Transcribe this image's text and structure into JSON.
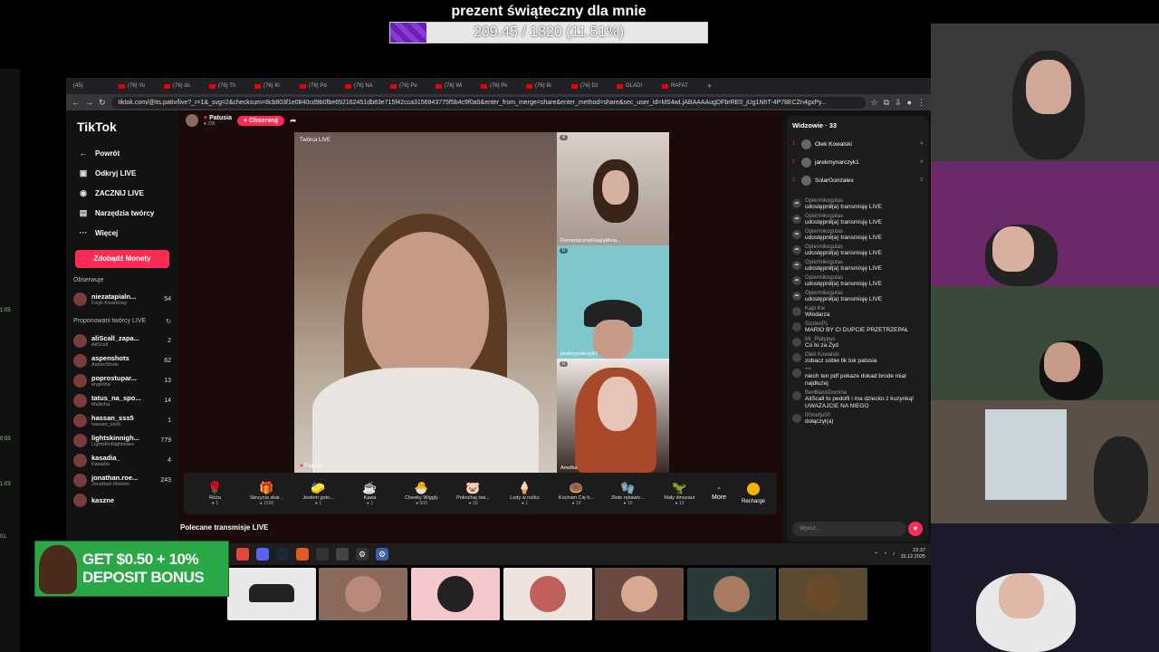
{
  "overlay": {
    "goal_title": "prezent świąteczny dla mnie",
    "goal_text": "209.45 / 1820 (11.51%)",
    "goal_fraction": 0.1151,
    "goal_color": "#6a1fb5"
  },
  "browser": {
    "tabs": [
      "(45)",
      "(76) Yo",
      "(76) do",
      "(76) Th",
      "(76) Ki",
      "(76) Pd",
      "(76) NA",
      "(76) Pe",
      "(76) Wi",
      "(76) Pk",
      "(76) Bi",
      "(76) Dz",
      "GLADI",
      "RAFAT"
    ],
    "url": "tiktok.com/@its.pativ/live?_r=1&_svg=2&checksum=8cb803f1e0840cd9b0fbe692162451db83e715f42cca3156943775f5b4c9f0a5&enter_from_merge=share&enter_method=share&sec_user_id=MS4wLjABAAAAugDFbrRE0_jUg1NhT-4P78ECZn4gxPy..."
  },
  "sidebar": {
    "logo": "TikTok",
    "items": [
      {
        "icon": "back-icon",
        "glyph": "←",
        "label": "Powrót"
      },
      {
        "icon": "live-icon",
        "glyph": "▣",
        "label": "Odkryj LIVE"
      },
      {
        "icon": "broadcast-icon",
        "glyph": "◉",
        "label": "ZACZNIJ LIVE"
      },
      {
        "icon": "tools-icon",
        "glyph": "▤",
        "label": "Narzędzia twórcy"
      },
      {
        "icon": "more-icon",
        "glyph": "···",
        "label": "Więcej"
      }
    ],
    "coins_button": "Zdobądź Monety",
    "following_title": "Obserwuje",
    "following": [
      {
        "name": "niezatapialn...",
        "sub": "Fizyk Kwantowy",
        "count": "54"
      }
    ],
    "suggested_title": "Proponowani twórcy LIVE",
    "suggested": [
      {
        "name": "aliScall_zapa...",
        "sub": "AliScall",
        "count": "2"
      },
      {
        "name": "aspenshots",
        "sub": "AspenShots",
        "count": "62"
      },
      {
        "name": "poprostupar...",
        "sub": "engelina",
        "count": "13"
      },
      {
        "name": "tatus_na_spo...",
        "sub": "Maliicha",
        "count": "14"
      },
      {
        "name": "hassan_sss5",
        "sub": "hassan_sss5",
        "count": "1"
      },
      {
        "name": "lightskinnigh...",
        "sub": "LightskinNightmare",
        "count": "779"
      },
      {
        "name": "kasadia_",
        "sub": "Kasadia",
        "count": "4"
      },
      {
        "name": "jonathan.roe...",
        "sub": "Jonathan Roehm",
        "count": "243"
      },
      {
        "name": "kaszne",
        "sub": "",
        "count": ""
      }
    ]
  },
  "stream": {
    "host_name": "Patusia",
    "host_viewers": "235",
    "follow_label": "+ Obserwuj",
    "creator_label": "Twórca LIVE",
    "main_name": "Patusia",
    "guests": [
      {
        "name": "RomantycznyKsiążęMeta...",
        "badge": "4"
      },
      {
        "name": "jarekmynarczyk1",
        "badge": "0"
      },
      {
        "name": "Amelka",
        "badge": "0"
      }
    ],
    "gifts": [
      {
        "icon": "🌹",
        "name": "Róża",
        "price": "1"
      },
      {
        "icon": "🎁",
        "name": "Skrzynia skar...",
        "price": "1500"
      },
      {
        "icon": "🧽",
        "name": "Jestem goto...",
        "price": "1"
      },
      {
        "icon": "☕",
        "name": "Kawa",
        "price": "1"
      },
      {
        "icon": "🐣",
        "name": "Cheeky Wiggly",
        "price": "500"
      },
      {
        "icon": "🐷",
        "name": "Pokochaj świ...",
        "price": "10"
      },
      {
        "icon": "🍦",
        "name": "Lody w rożku",
        "price": "1"
      },
      {
        "icon": "🍩",
        "name": "Kocham Cię b...",
        "price": "10"
      },
      {
        "icon": "🧤",
        "name": "Złote rękawic...",
        "price": "10"
      },
      {
        "icon": "🦖",
        "name": "Mały dinozaur",
        "price": "10"
      }
    ],
    "more_label": "More",
    "recharge_label": "Recharge",
    "related_title": "Polecane transmisje LIVE"
  },
  "chat": {
    "viewers_title": "Widzowie · 33",
    "viewers": [
      {
        "rank": "1",
        "name": "Olek Kowalski",
        "count": "4"
      },
      {
        "rank": "2",
        "name": "jarekmynarczyk1",
        "count": "4"
      },
      {
        "rank": "3",
        "name": "SolarGonzales",
        "count": "3"
      }
    ],
    "messages": [
      {
        "user": "Opiermikogutas",
        "text": "udostępnił(a) transmisję LIVE"
      },
      {
        "user": "Opiermikogutas",
        "text": "udostępnił(a) transmisję LIVE"
      },
      {
        "user": "Opiermikogutas",
        "text": "udostępnił(a) transmisję LIVE"
      },
      {
        "user": "Opiermikogutas",
        "text": "udostępnił(a) transmisję LIVE"
      },
      {
        "user": "Opiermikogutas",
        "text": "udostępnił(a) transmisję LIVE"
      },
      {
        "user": "Opiermikogutas",
        "text": "udostępnił(a) transmisję LIVE"
      },
      {
        "user": "Opiermikogutas",
        "text": "udostępnił(a) transmisję LIVE"
      },
      {
        "user": "Kapi Kw",
        "text": "Włodarza"
      },
      {
        "user": "SzotexPL",
        "text": "MARIO BY CI DUPCIE PRZETRZEPAŁ"
      },
      {
        "user": "Mr_Platypus",
        "text": "Co to za Żyd"
      },
      {
        "user": "Olek Kowalski",
        "text": "zobacz sobie tik tok patusia"
      },
      {
        "user": "***",
        "text": "niech ten pdf pokaze dokad brode mial najdłużej"
      },
      {
        "user": "BenBlackDomina",
        "text": "AliScall to pedofil i ma dziecko z kuzynką! UWAŻAJCIE NA NIEGO"
      },
      {
        "user": "00mefju00",
        "text": "dołączył(a)"
      }
    ],
    "input_placeholder": "Wpisz..."
  },
  "taskbar": {
    "time": "23:37",
    "date": "15.12.2025"
  },
  "ad": {
    "line1": "GET $0.50 + 10%",
    "line2": "DEPOSIT BONUS"
  },
  "left_strip": [
    "1:05",
    "0:55",
    "1:03",
    "01"
  ]
}
